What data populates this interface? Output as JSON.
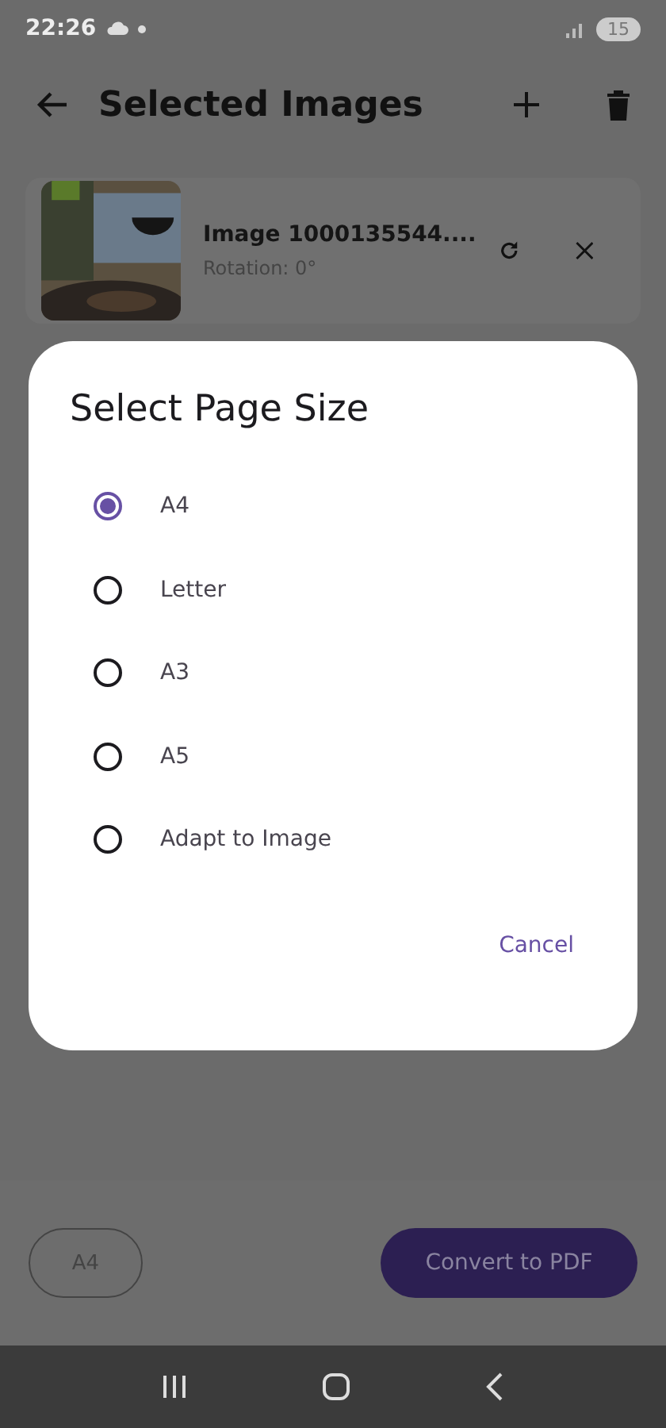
{
  "status_bar": {
    "time": "22:26",
    "battery": "15"
  },
  "app_bar": {
    "title": "Selected Images"
  },
  "images": [
    {
      "name": "Image 1000135544....",
      "rotation": "Rotation: 0°"
    }
  ],
  "dialog": {
    "title": "Select Page Size",
    "options": [
      {
        "label": "A4",
        "selected": true
      },
      {
        "label": "Letter",
        "selected": false
      },
      {
        "label": "A3",
        "selected": false
      },
      {
        "label": "A5",
        "selected": false
      },
      {
        "label": "Adapt to Image",
        "selected": false
      }
    ],
    "cancel": "Cancel"
  },
  "bottom_bar": {
    "page_size": "A4",
    "convert": "Convert to PDF"
  }
}
